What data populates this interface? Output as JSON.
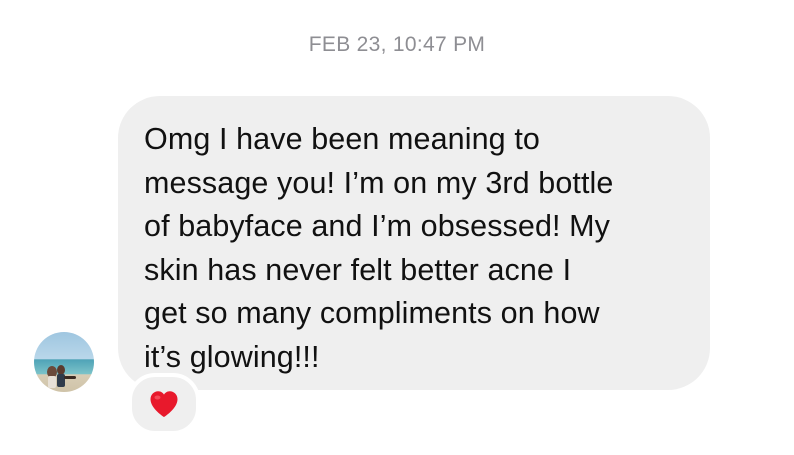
{
  "thread": {
    "timestamp": "FEB 23, 10:47 PM"
  },
  "message": {
    "lines": [
      "Omg I have been meaning to",
      "message you! I’m on my 3rd bottle",
      "of babyface and I’m obsessed! My",
      "skin has never felt better acne I",
      "get so many compliments on how",
      "it’s glowing!!!"
    ],
    "reaction": "heart-icon",
    "bubble_color": "#efefef",
    "reaction_color": "#e8192c"
  },
  "sender": {
    "avatar": "profile-photo"
  }
}
